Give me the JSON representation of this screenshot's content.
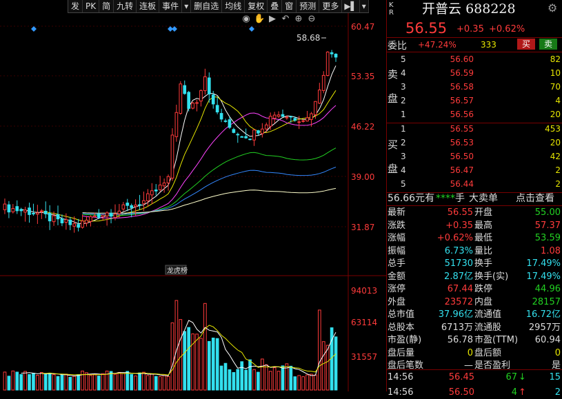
{
  "toolbar": [
    {
      "label": "发"
    },
    {
      "label": "PK"
    },
    {
      "label": "简"
    },
    {
      "label": "九转"
    },
    {
      "label": "连板"
    },
    {
      "label": "事件"
    },
    {
      "label": "▾",
      "arrow": true
    },
    {
      "label": "删自选"
    },
    {
      "label": "均线"
    },
    {
      "label": "复权"
    },
    {
      "label": "叠"
    },
    {
      "label": "窗"
    },
    {
      "label": "预测"
    },
    {
      "label": "更多"
    },
    {
      "label": "▶▌",
      "arrow": true
    },
    {
      "label": "▾",
      "arrow": true
    }
  ],
  "chart_tools": [
    "eye-icon",
    "hand-icon",
    "play-icon",
    "undo-icon",
    "plus-icon",
    "minus-icon"
  ],
  "price_axis": [
    "60.47",
    "53.35",
    "46.22",
    "39.00",
    "31.87"
  ],
  "volume_axis": [
    "94013",
    "63114",
    "31557"
  ],
  "max_label": "58.68",
  "event_tag": "龙虎榜",
  "stock": {
    "kr": "K R",
    "name": "开普云",
    "code": "688228",
    "price": "56.55",
    "change": "+0.35",
    "change_pct": "+0.62%"
  },
  "weibi": {
    "label": "委比",
    "pct": "+47.24%",
    "diff": "333",
    "sell_btn": "买",
    "buy_btn": "卖"
  },
  "sell_label": [
    "卖",
    "盘"
  ],
  "buy_label": [
    "买",
    "盘"
  ],
  "asks": [
    {
      "lv": "5",
      "price": "56.60",
      "vol": "82"
    },
    {
      "lv": "4",
      "price": "56.59",
      "vol": "10"
    },
    {
      "lv": "3",
      "price": "56.58",
      "vol": "70"
    },
    {
      "lv": "2",
      "price": "56.57",
      "vol": "4"
    },
    {
      "lv": "1",
      "price": "56.56",
      "vol": "20"
    }
  ],
  "bids": [
    {
      "lv": "1",
      "price": "56.55",
      "vol": "453"
    },
    {
      "lv": "2",
      "price": "56.53",
      "vol": "20"
    },
    {
      "lv": "3",
      "price": "56.50",
      "vol": "42"
    },
    {
      "lv": "4",
      "price": "56.47",
      "vol": "2"
    },
    {
      "lv": "5",
      "price": "56.44",
      "vol": "2"
    }
  ],
  "midbar": {
    "val": "56.66",
    "unit": "元有",
    "stars": "****",
    "hand": "手",
    "big": "大卖单",
    "link": "点击查看"
  },
  "quotes": [
    {
      "l1": "最新",
      "v1": "56.55",
      "c1": "red",
      "l2": "开盘",
      "v2": "55.00",
      "c2": "green"
    },
    {
      "l1": "涨跌",
      "v1": "+0.35",
      "c1": "red",
      "l2": "最高",
      "v2": "57.37",
      "c2": "red"
    },
    {
      "l1": "涨幅",
      "v1": "+0.62%",
      "c1": "red",
      "l2": "最低",
      "v2": "53.59",
      "c2": "green"
    },
    {
      "l1": "振幅",
      "v1": "6.73%",
      "c1": "cyan",
      "l2": "量比",
      "v2": "1.08",
      "c2": "red"
    },
    {
      "l1": "总手",
      "v1": "51730",
      "c1": "cyan",
      "l2": "换手",
      "v2": "17.49%",
      "c2": "cyan"
    },
    {
      "l1": "金额",
      "v1": "2.87亿",
      "c1": "cyan",
      "l2": "换手(实)",
      "v2": "17.49%",
      "c2": "cyan"
    },
    {
      "l1": "涨停",
      "v1": "67.44",
      "c1": "red",
      "l2": "跌停",
      "v2": "44.96",
      "c2": "green"
    },
    {
      "l1": "外盘",
      "v1": "23572",
      "c1": "red",
      "l2": "内盘",
      "v2": "28157",
      "c2": "green"
    },
    {
      "l1": "总市值",
      "v1": "37.96亿",
      "c1": "cyan",
      "l2": "流通值",
      "v2": "16.72亿",
      "c2": "cyan"
    },
    {
      "l1": "总股本",
      "v1": "6713万",
      "c1": "white",
      "l2": "流通股",
      "v2": "2957万",
      "c2": "white"
    },
    {
      "l1": "市盈(静)",
      "v1": "56.78",
      "c1": "white",
      "l2": "市盈(TTM)",
      "v2": "60.94",
      "c2": "white"
    },
    {
      "l1": "盘后量",
      "v1": "0",
      "c1": "yellow",
      "l2": "盘后额",
      "v2": "0",
      "c2": "yellow"
    },
    {
      "l1": "盘后笔数",
      "v1": "—",
      "c1": "white",
      "l2": "是否盈利",
      "v2": "是",
      "c2": "white"
    }
  ],
  "ticks": [
    {
      "time": "14:56",
      "price": "56.45",
      "vol": "67",
      "arrow": "↓",
      "count": "15"
    },
    {
      "time": "14:56",
      "price": "56.50",
      "vol": "4",
      "arrow": "↑",
      "count": "2"
    }
  ],
  "colors": {
    "up": "#ff3b3b",
    "down": "#33e0ee",
    "bg": "#000000",
    "border": "#7a0000"
  }
}
